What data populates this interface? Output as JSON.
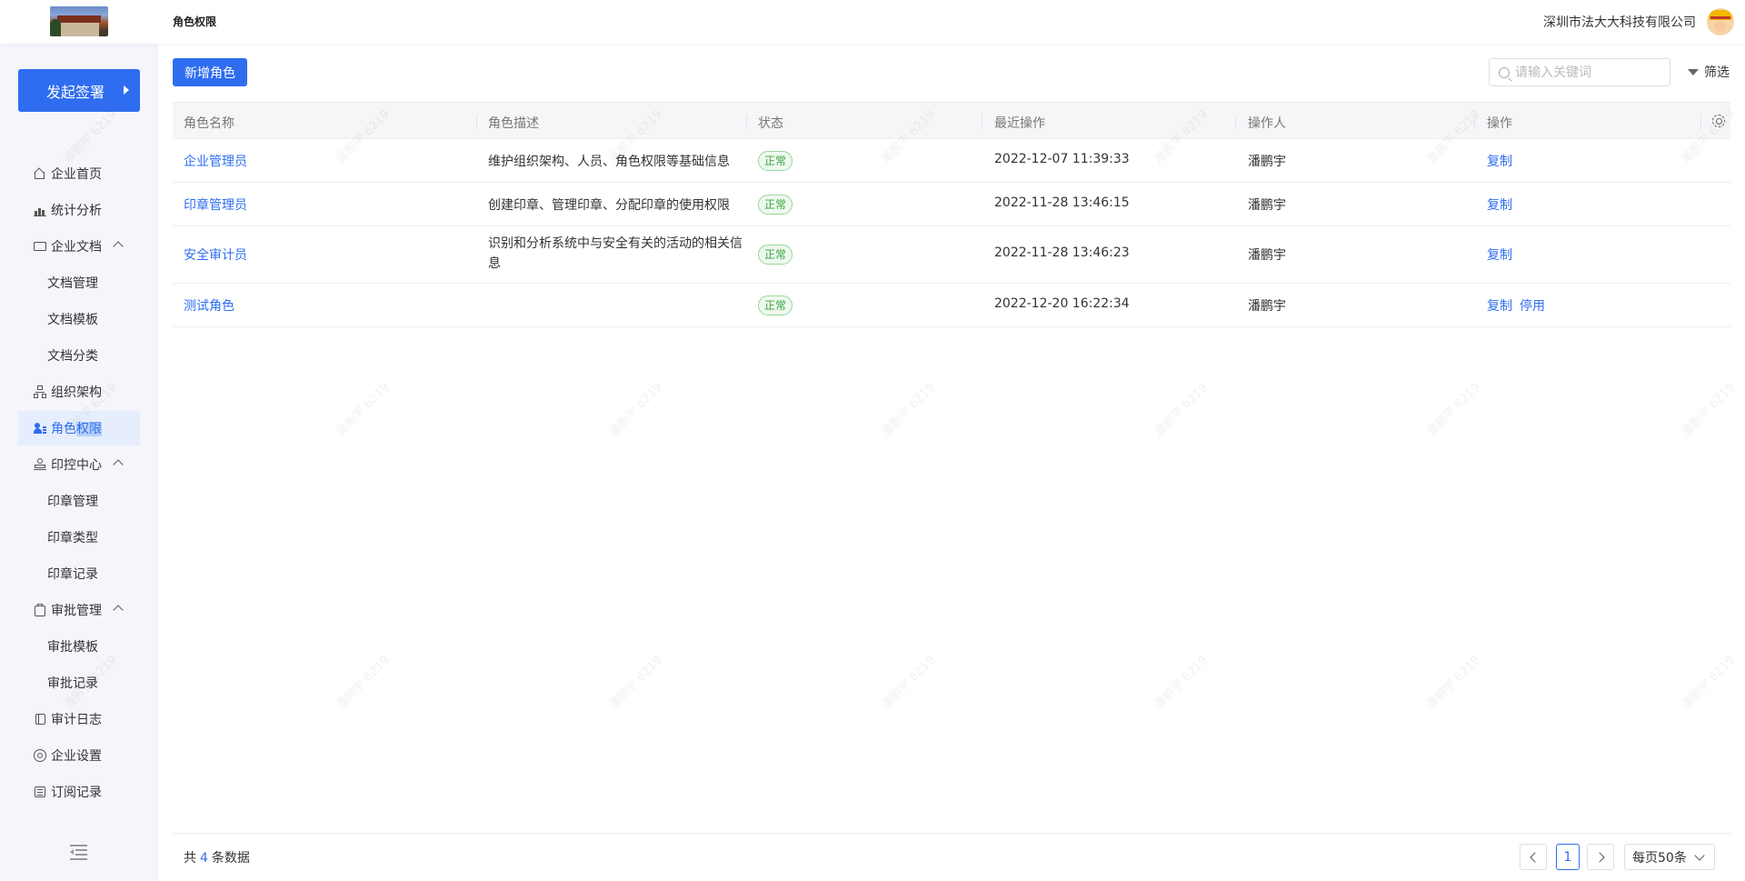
{
  "header": {
    "page_title": "角色权限",
    "company": "深圳市法大大科技有限公司"
  },
  "sidebar": {
    "launch_button": "发起签署",
    "items": [
      {
        "label": "企业首页",
        "icon": "home-icon"
      },
      {
        "label": "统计分析",
        "icon": "bar-chart-icon"
      },
      {
        "label": "企业文档",
        "icon": "folder-icon"
      },
      {
        "label": "文档管理"
      },
      {
        "label": "文档模板"
      },
      {
        "label": "文档分类"
      },
      {
        "label": "组织架构",
        "icon": "org-chart-icon"
      },
      {
        "label": "角色权限",
        "icon": "user-role-icon"
      },
      {
        "label": "印控中心",
        "icon": "stamp-icon"
      },
      {
        "label": "印章管理"
      },
      {
        "label": "印章类型"
      },
      {
        "label": "印章记录"
      },
      {
        "label": "审批管理",
        "icon": "clipboard-check-icon"
      },
      {
        "label": "审批模板"
      },
      {
        "label": "审批记录"
      },
      {
        "label": "审计日志",
        "icon": "notebook-icon"
      },
      {
        "label": "企业设置",
        "icon": "settings-icon"
      },
      {
        "label": "订阅记录",
        "icon": "document-list-icon"
      }
    ]
  },
  "toolbar": {
    "add_label": "新增角色",
    "search_placeholder": "请输入关键词",
    "filter_label": "筛选"
  },
  "table": {
    "columns": [
      "角色名称",
      "角色描述",
      "状态",
      "最近操作",
      "操作人",
      "操作"
    ],
    "rows": [
      {
        "name": "企业管理员",
        "desc": "维护组织架构、人员、角色权限等基础信息",
        "status": "正常",
        "time": "2022-12-07 11:39:33",
        "operator": "潘鹏宇",
        "actions": [
          "复制"
        ]
      },
      {
        "name": "印章管理员",
        "desc": "创建印章、管理印章、分配印章的使用权限",
        "status": "正常",
        "time": "2022-11-28 13:46:15",
        "operator": "潘鹏宇",
        "actions": [
          "复制"
        ]
      },
      {
        "name": "安全审计员",
        "desc": "识别和分析系统中与安全有关的活动的相关信息",
        "status": "正常",
        "time": "2022-11-28 13:46:23",
        "operator": "潘鹏宇",
        "actions": [
          "复制"
        ]
      },
      {
        "name": "测试角色",
        "desc": "",
        "status": "正常",
        "time": "2022-12-20 16:22:34",
        "operator": "潘鹏宇",
        "actions": [
          "复制",
          "停用"
        ]
      }
    ]
  },
  "footer": {
    "total_prefix": "共",
    "total_count": "4",
    "total_suffix": "条数据",
    "current_page": "1",
    "page_size": "每页50条"
  },
  "watermark": "潘鹏宇 6219",
  "colors": {
    "accent": "#2f6df0",
    "status_ok": "#3aa542"
  }
}
